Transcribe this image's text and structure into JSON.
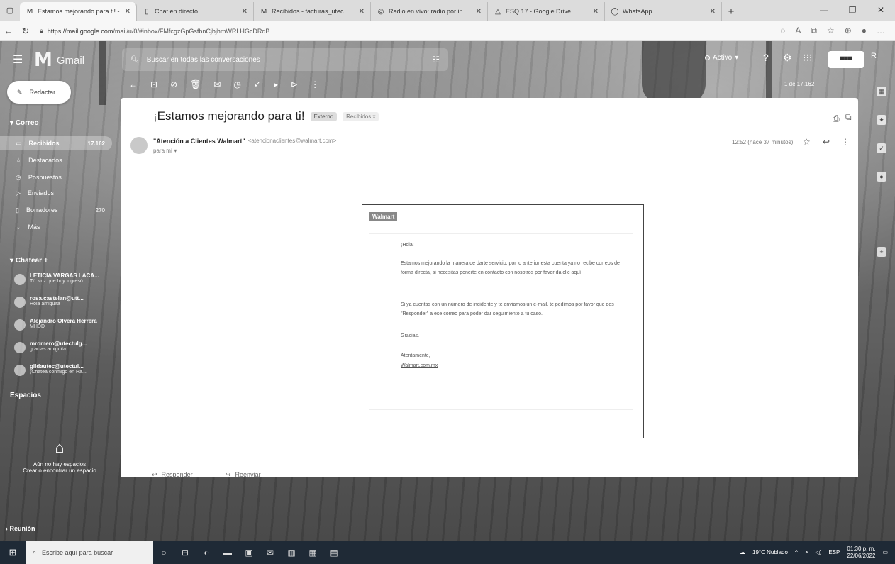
{
  "browser": {
    "tabs": [
      {
        "label": "Estamos mejorando para ti! - ",
        "active": true
      },
      {
        "label": "Chat en directo",
        "active": false
      },
      {
        "label": "Recibidos - facturas_utec@utec",
        "active": false
      },
      {
        "label": "Radio en vivo: radio por in",
        "active": false
      },
      {
        "label": "ESQ 17 - Google Drive",
        "active": false
      },
      {
        "label": "WhatsApp",
        "active": false
      }
    ],
    "url_host": "https://mail.google.com",
    "url_path": "/mail/u/0/#inbox/FMfcgzGpGsfbnCjbjhmWRLHGcDRdB"
  },
  "gmail": {
    "app_name": "Gmail",
    "search_placeholder": "Buscar en todas las conversaciones",
    "status": "Activo",
    "compose_label": "Redactar",
    "mail_section": "Correo",
    "nav": [
      {
        "label": "Recibidos",
        "count": "17.162",
        "selected": true
      },
      {
        "label": "Destacados",
        "count": "",
        "selected": false
      },
      {
        "label": "Pospuestos",
        "count": "",
        "selected": false
      },
      {
        "label": "Enviados",
        "count": "",
        "selected": false
      },
      {
        "label": "Borradores",
        "count": "270",
        "selected": false
      },
      {
        "label": "Más",
        "count": "",
        "selected": false
      }
    ],
    "chat_section": "Chatear",
    "chats": [
      {
        "name": "LETICIA VARGAS LACA...",
        "message": "Tú: voz que hoy ingresó..."
      },
      {
        "name": "rosa.castelan@utt...",
        "message": "Hola amiguita"
      },
      {
        "name": "Alejandro Olvera Herrera",
        "message": "MHDD"
      },
      {
        "name": "mromero@utectulg...",
        "message": "gracias amiguita"
      },
      {
        "name": "gildautec@utectul...",
        "message": "¡Chatea conmigo en Ha..."
      }
    ],
    "spaces_section": "Espacios",
    "spaces_empty": "Aún no hay espacios",
    "spaces_cta": "Crear o encontrar un espacio",
    "meeting_section": "Reunión",
    "pager": "1 de 17.162",
    "message": {
      "subject": "¡Estamos mejorando para ti!",
      "chip_external": "Externo",
      "chip_inbox": "Recibidos x",
      "sender_name": "\"Atención a Clientes Walmart\"",
      "sender_email": "<atencionaclientes@walmart.com>",
      "to": "para mí",
      "time": "12:52 (hace 37 minutos)",
      "reply_label": "Responder",
      "forward_label": "Reenviar"
    },
    "email": {
      "logo": "Walmart",
      "greeting": "¡Hola!",
      "p1": "Estamos mejorando la manera de darte servicio, por lo anterior esta cuenta ya no recibe correos de forma directa, si necesitas ponerte en contacto con nosotros por favor da clic ",
      "p1_link": "aquí",
      "p2": "Si ya cuentas con un número de incidente y te enviamos un e-mail, te pedimos por favor que des \"Responder\" a ese correo para poder dar seguimiento a tu caso.",
      "thanks": "Gracias.",
      "closing": "Atentamente,",
      "signature_link": "Walmart.com.mx"
    }
  },
  "taskbar": {
    "search_placeholder": "Escribe aquí para buscar",
    "weather": "19°C Nublado",
    "lang": "ESP",
    "time": "01:30 p. m.",
    "date": "22/06/2022"
  }
}
